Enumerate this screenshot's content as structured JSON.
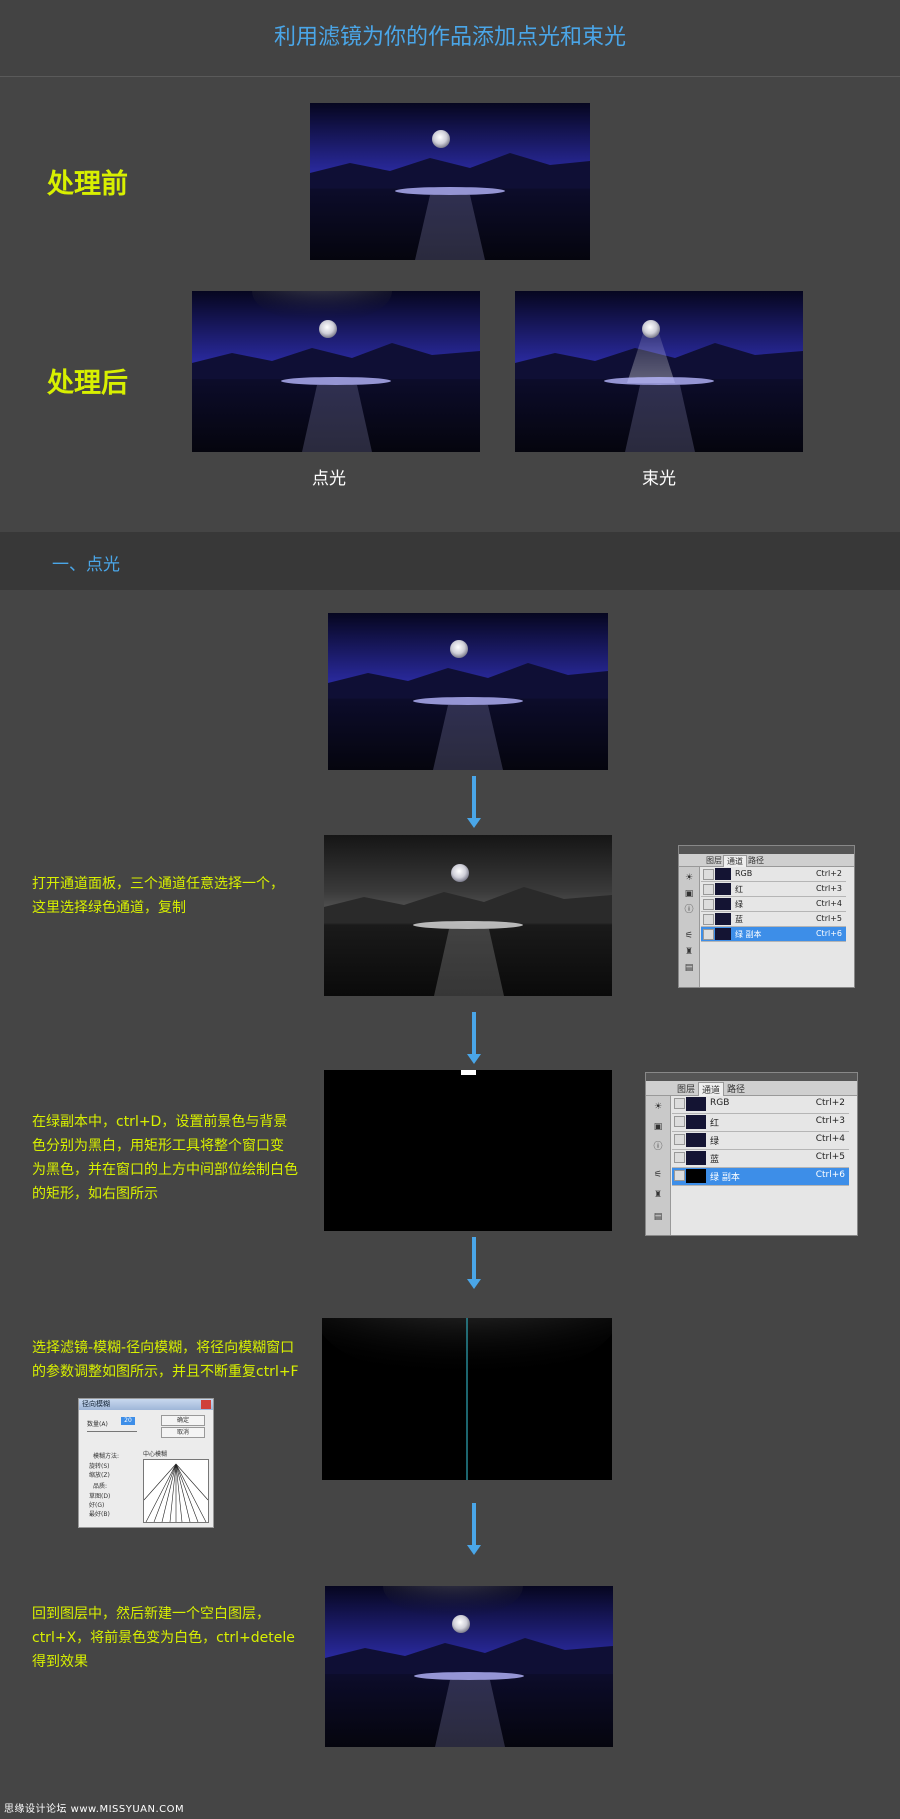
{
  "title": "利用滤镜为你的作品添加点光和束光",
  "before_label": "处理前",
  "after_label": "处理后",
  "caption_spot": "点光",
  "caption_beam": "束光",
  "section_title": "一、点光",
  "steps": [
    {
      "text": "打开通道面板，三个通道任意选择一个，\n这里选择绿色通道，复制"
    },
    {
      "text": "在绿副本中，ctrl+D，设置前景色与背景\n色分别为黑白，用矩形工具将整个窗口变\n为黑色，并在窗口的上方中间部位绘制白色\n的矩形，如右图所示"
    },
    {
      "text": "选择滤镜-模糊-径向模糊，将径向模糊窗口\n的参数调整如图所示，并且不断重复ctrl+F"
    },
    {
      "text": "回到图层中，然后新建一个空白图层，\nctrl+X，将前景色变为白色，ctrl+detele\n得到效果"
    }
  ],
  "channels_panel_1": {
    "tabs": [
      "图层",
      "通道",
      "路径"
    ],
    "rows": [
      {
        "name": "RGB",
        "shortcut": "Ctrl+2"
      },
      {
        "name": "红",
        "shortcut": "Ctrl+3"
      },
      {
        "name": "绿",
        "shortcut": "Ctrl+4"
      },
      {
        "name": "蓝",
        "shortcut": "Ctrl+5"
      },
      {
        "name": "绿 副本",
        "shortcut": "Ctrl+6"
      }
    ]
  },
  "channels_panel_2": {
    "tabs": [
      "图层",
      "通道",
      "路径"
    ],
    "rows": [
      {
        "name": "RGB",
        "shortcut": "Ctrl+2"
      },
      {
        "name": "红",
        "shortcut": "Ctrl+3"
      },
      {
        "name": "绿",
        "shortcut": "Ctrl+4"
      },
      {
        "name": "蓝",
        "shortcut": "Ctrl+5"
      },
      {
        "name": "绿 副本",
        "shortcut": "Ctrl+6"
      }
    ]
  },
  "radial_blur_dialog": {
    "title": "径向模糊",
    "amount_label": "数量(A)",
    "amount_value": "20",
    "ok": "确定",
    "cancel": "取消",
    "method_label": "模糊方法:",
    "method_spin": "旋转(S)",
    "method_zoom": "缩放(Z)",
    "quality_label": "品质:",
    "quality_draft": "草图(D)",
    "quality_good": "好(G)",
    "quality_best": "最好(B)",
    "center_label": "中心模糊"
  },
  "footer": "思缘设计论坛 www.MISSYUAN.COM",
  "colors": {
    "accent_blue": "#4aa6e8",
    "label_yellow": "#d8f000",
    "background": "#454545"
  }
}
